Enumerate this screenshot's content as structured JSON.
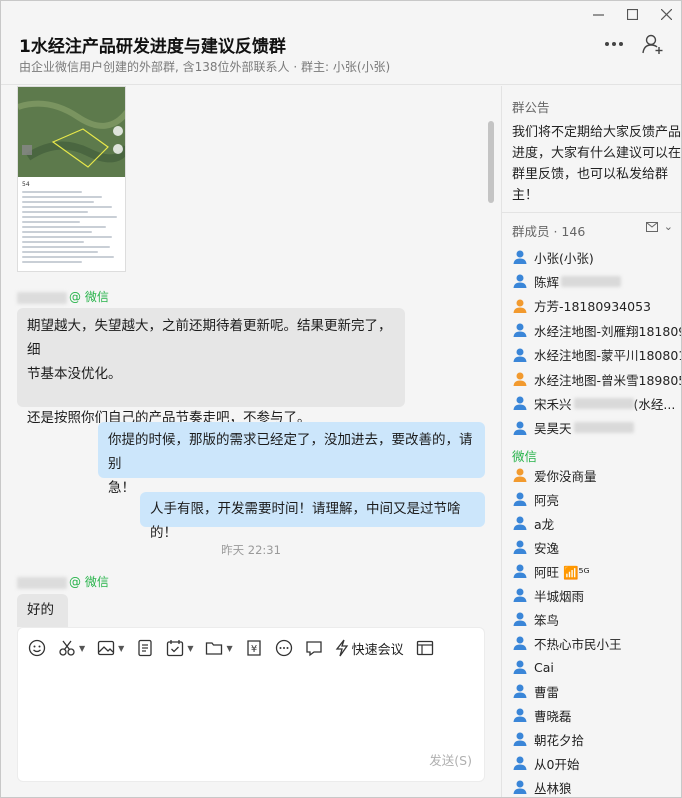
{
  "window": {
    "title": "1水经注产品研发进度与建议反馈群",
    "subtitle": "由企业微信用户创建的外部群, 含138位外部联系人 · 群主: 小张(小张)"
  },
  "chat": {
    "image_caption": "54",
    "msg1": {
      "sender_tag": "@ 微信",
      "text_line1": "期望越大，失望越大，之前还期待着更新呢。结果更新完了，细",
      "text_line2": "节基本没优化。",
      "text_line3": "还是按照你们自己的产品节奏走吧，不参与了。"
    },
    "msg2": {
      "text_line1": "你提的时候，那版的需求已经定了，没加进去，要改善的，请别",
      "text_line2": "急！"
    },
    "msg3": {
      "text": "人手有限，开发需要时间！请理解，中间又是过节啥的！"
    },
    "timestamp": "昨天 22:31",
    "msg4": {
      "sender_tag": "@ 微信",
      "text": "好的"
    }
  },
  "composer": {
    "meeting_label": "快速会议",
    "send_label": "发送(S)"
  },
  "side": {
    "notice_title": "群公告",
    "notice_text": "我们将不定期给大家反馈产品进度，大家有什么建议可以在群里反馈，也可以私发给群主！",
    "members_title": "群成员 · 146",
    "members": [
      {
        "name": "小张(小张)",
        "color": "#3a86d8",
        "blur": false
      },
      {
        "name": "陈辉",
        "color": "#3a86d8",
        "blur": true
      },
      {
        "name": "方芳-18180934053",
        "color": "#f29a2e",
        "blur": false
      },
      {
        "name": "水经注地图-刘雁翔181809...",
        "color": "#3a86d8",
        "blur": false
      },
      {
        "name": "水经注地图-蒙平川180801...",
        "color": "#3a86d8",
        "blur": false
      },
      {
        "name": "水经注地图-曾米雪189805...",
        "color": "#f29a2e",
        "blur": false
      },
      {
        "name": "宋禾兴",
        "suffix": "(水经...",
        "color": "#3a86d8",
        "blur": true
      },
      {
        "name": "吴昊天",
        "color": "#3a86d8",
        "blur": true
      }
    ],
    "wx_title": "微信",
    "wx_members": [
      {
        "name": "爱你没商量",
        "color": "#f29a2e"
      },
      {
        "name": "阿亮",
        "color": "#3a86d8"
      },
      {
        "name": "a龙",
        "color": "#3a86d8"
      },
      {
        "name": "安逸",
        "color": "#3a86d8"
      },
      {
        "name": "阿旺 📶⁵ᴳ",
        "color": "#3a86d8"
      },
      {
        "name": "半城烟雨",
        "color": "#3a86d8"
      },
      {
        "name": "笨鸟",
        "color": "#3a86d8"
      },
      {
        "name": "不热心市民小王",
        "color": "#3a86d8"
      },
      {
        "name": "Cai",
        "color": "#3a86d8"
      },
      {
        "name": "曹雷",
        "color": "#3a86d8"
      },
      {
        "name": "曹晓磊",
        "color": "#3a86d8"
      },
      {
        "name": "朝花夕拾",
        "color": "#3a86d8"
      },
      {
        "name": "从0开始",
        "color": "#3a86d8"
      },
      {
        "name": "丛林狼",
        "color": "#3a86d8"
      }
    ]
  }
}
